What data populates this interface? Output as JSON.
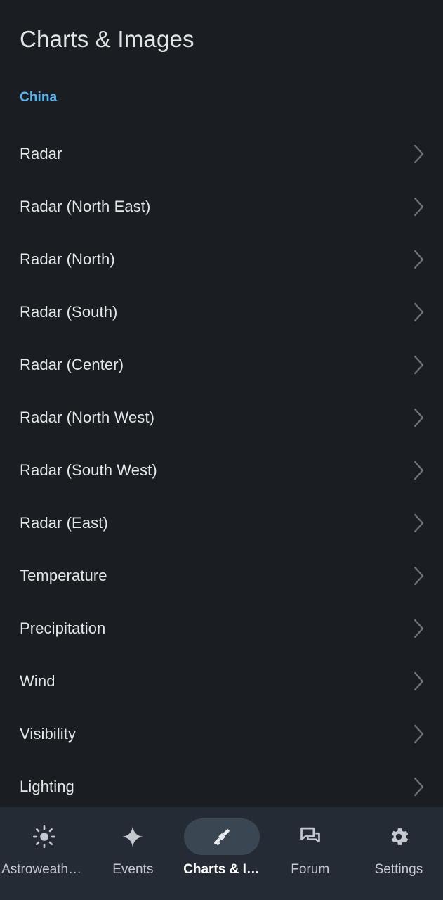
{
  "header": {
    "title": "Charts & Images"
  },
  "section": {
    "label": "China"
  },
  "colors": {
    "background": "#1a1e23",
    "nav_background": "#242b34",
    "accent": "#57b4ef",
    "text_primary": "#e4e7ea",
    "chevron": "#6e757b",
    "active_pill": "#3a4753"
  },
  "list": {
    "items": [
      {
        "label": "Radar",
        "icon": "chevron-right-icon"
      },
      {
        "label": "Radar (North East)",
        "icon": "chevron-right-icon"
      },
      {
        "label": "Radar (North)",
        "icon": "chevron-right-icon"
      },
      {
        "label": "Radar (South)",
        "icon": "chevron-right-icon"
      },
      {
        "label": "Radar (Center)",
        "icon": "chevron-right-icon"
      },
      {
        "label": "Radar (North West)",
        "icon": "chevron-right-icon"
      },
      {
        "label": "Radar (South West)",
        "icon": "chevron-right-icon"
      },
      {
        "label": "Radar (East)",
        "icon": "chevron-right-icon"
      },
      {
        "label": "Temperature",
        "icon": "chevron-right-icon"
      },
      {
        "label": "Precipitation",
        "icon": "chevron-right-icon"
      },
      {
        "label": "Wind",
        "icon": "chevron-right-icon"
      },
      {
        "label": "Visibility",
        "icon": "chevron-right-icon"
      },
      {
        "label": "Lighting",
        "icon": "chevron-right-icon"
      }
    ]
  },
  "bottom_nav": {
    "items": [
      {
        "label": "Astroweath…",
        "icon": "sun-icon",
        "active": false
      },
      {
        "label": "Events",
        "icon": "sparkle-icon",
        "active": false
      },
      {
        "label": "Charts & I…",
        "icon": "satellite-icon",
        "active": true
      },
      {
        "label": "Forum",
        "icon": "chat-bubbles-icon",
        "active": false
      },
      {
        "label": "Settings",
        "icon": "gear-icon",
        "active": false
      }
    ]
  }
}
